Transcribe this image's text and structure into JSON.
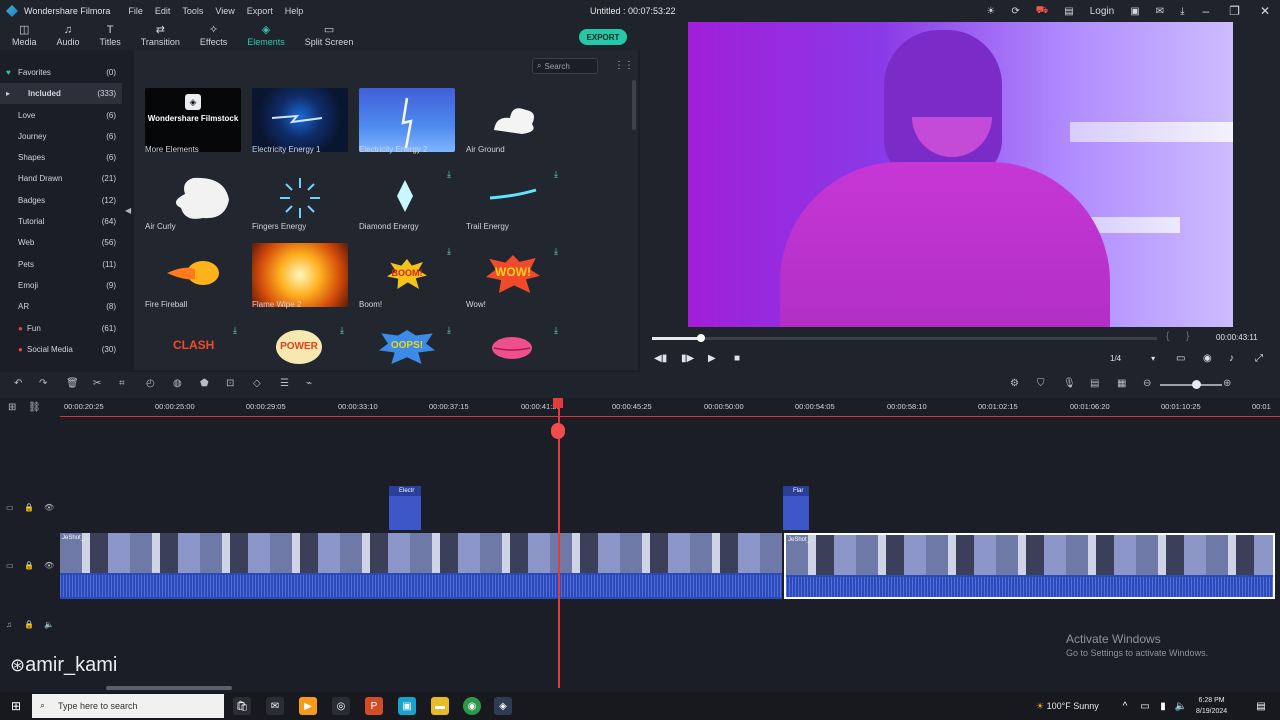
{
  "window": {
    "app_name": "Wondershare Filmora",
    "menu": [
      "File",
      "Edit",
      "Tools",
      "View",
      "Export",
      "Help"
    ],
    "document_title": "Untitled : 00:07:53:22",
    "login_label": "Login"
  },
  "toolbar": {
    "tabs": [
      {
        "label": "Media",
        "icon": "media-icon"
      },
      {
        "label": "Audio",
        "icon": "audio-icon"
      },
      {
        "label": "Titles",
        "icon": "titles-icon"
      },
      {
        "label": "Transition",
        "icon": "transition-icon"
      },
      {
        "label": "Effects",
        "icon": "effects-icon"
      },
      {
        "label": "Elements",
        "icon": "elements-icon"
      },
      {
        "label": "Split Screen",
        "icon": "split-screen-icon"
      }
    ],
    "active_tab": "Elements",
    "export_label": "EXPORT"
  },
  "categories": [
    {
      "label": "Favorites",
      "count": "(0)"
    },
    {
      "label": "Included",
      "count": "(333)"
    },
    {
      "label": "Love",
      "count": "(6)"
    },
    {
      "label": "Journey",
      "count": "(6)"
    },
    {
      "label": "Shapes",
      "count": "(6)"
    },
    {
      "label": "Hand Drawn",
      "count": "(21)"
    },
    {
      "label": "Badges",
      "count": "(12)"
    },
    {
      "label": "Tutorial",
      "count": "(64)"
    },
    {
      "label": "Web",
      "count": "(56)"
    },
    {
      "label": "Pets",
      "count": "(11)"
    },
    {
      "label": "Emoji",
      "count": "(9)"
    },
    {
      "label": "AR",
      "count": "(8)"
    },
    {
      "label": "Fun",
      "count": "(61)"
    },
    {
      "label": "Social Media",
      "count": "(30)"
    }
  ],
  "search": {
    "placeholder": "Search"
  },
  "assets": [
    {
      "label": "More Elements",
      "thumb_text": "Wondershare Filmstock"
    },
    {
      "label": "Electricity Energy 1"
    },
    {
      "label": "Electricity Energy 2"
    },
    {
      "label": "Air Ground"
    },
    {
      "label": "Air Curly"
    },
    {
      "label": "Fingers Energy"
    },
    {
      "label": "Diamond Energy"
    },
    {
      "label": "Trail Energy"
    },
    {
      "label": "Fire Fireball"
    },
    {
      "label": "Flame Wipe 2"
    },
    {
      "label": "Boom!",
      "thumb_text": "BOOM!"
    },
    {
      "label": "Wow!",
      "thumb_text": "WOW!"
    },
    {
      "label": "",
      "thumb_text": "CLASH"
    },
    {
      "label": "",
      "thumb_text": "POWER"
    },
    {
      "label": "",
      "thumb_text": "OOPS!"
    },
    {
      "label": ""
    }
  ],
  "preview": {
    "timecode": "00:00:43:11",
    "zoom": "1/4",
    "progress": 0.09
  },
  "timeline": {
    "ruler": [
      "00:00:20:25",
      "00:00:25:00",
      "00:00:29:05",
      "00:00:33:10",
      "00:00:37:15",
      "00:00:41:20",
      "00:00:45:25",
      "00:00:50:00",
      "00:00:54:05",
      "00:00:58:10",
      "00:01:02:15",
      "00:01:06:20",
      "00:01:10:25",
      "00:01"
    ],
    "element_clips": [
      "Electr",
      "Flar"
    ],
    "video_clips": [
      "JeShot_...",
      "JeShot_..."
    ]
  },
  "overlay": {
    "activate_title": "Activate Windows",
    "activate_sub": "Go to Settings to activate Windows.",
    "watermark": "amir_kami"
  },
  "taskbar": {
    "search_placeholder": "Type here to search",
    "weather": "100°F  Sunny",
    "time": "6:28 PM",
    "date": "8/19/2024"
  }
}
